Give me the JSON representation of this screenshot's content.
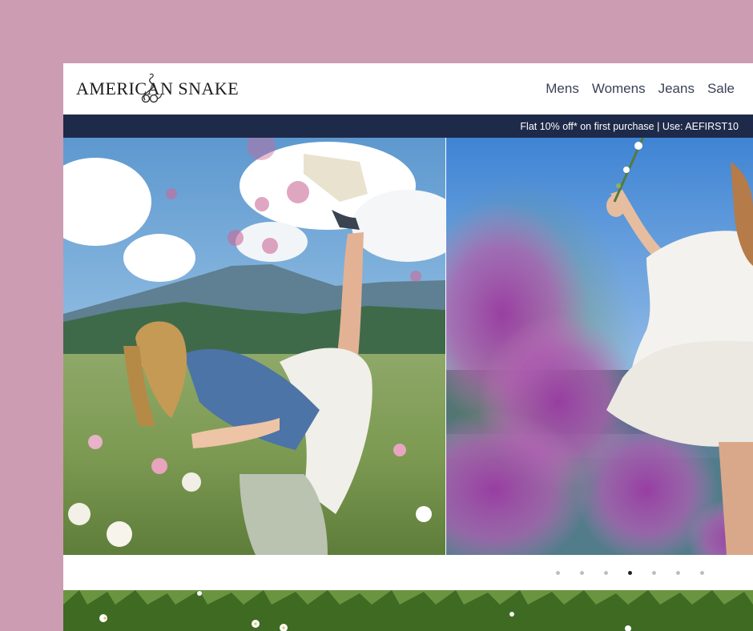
{
  "header": {
    "logo_text": "AMERICAN SNAKE",
    "nav": [
      {
        "label": "Mens"
      },
      {
        "label": "Womens"
      },
      {
        "label": "Jeans"
      },
      {
        "label": "Sale"
      }
    ]
  },
  "promo": {
    "text": "Flat 10% off* on first purchase | Use: AEFIRST10"
  },
  "carousel": {
    "slide_count": 7,
    "active_index": 3
  },
  "colors": {
    "page_background": "#cc9cb2",
    "promo_bar": "#1e2a4a",
    "nav_text": "#3a4256",
    "dot_inactive": "#bfbfbf",
    "dot_active": "#222222"
  }
}
